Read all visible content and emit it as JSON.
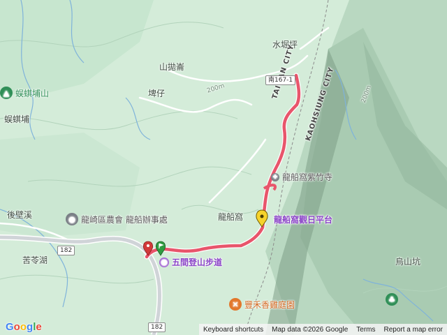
{
  "map": {
    "places": {
      "shuijueping": "水堀坪",
      "shanpaohu": "山拋崙",
      "pizai": "埤仔",
      "wuqibushan": "蜈蜞埔山",
      "wuqibu": "蜈蜞埔",
      "houbixi": "後壁溪",
      "longchuanwo": "龍船窩",
      "kulinhu": "苦苓湖",
      "wushankeng": "烏山坑"
    },
    "pois": {
      "farmers_assoc": "龍崎區農會 龍船辦事處",
      "zizhu_temple": "龍船窩紫竹寺",
      "sunrise_platform": "龍船窩觀日平台",
      "wujian_trail": "五間登山步道",
      "fenghe_restaurant": "豐禾香雞庭園"
    },
    "city_labels": {
      "tainan": "TAINAN CITY",
      "kaohsiung": "KAOHSIUNG CITY"
    },
    "elevation_labels": [
      "200m",
      "200m"
    ],
    "road_shields": {
      "nan167": "南167-1",
      "r182_top": "182",
      "r182_bottom": "182"
    },
    "colors": {
      "route": "#e8556b",
      "route_outline": "#ffffff",
      "poi_purple": "#9b59d0",
      "poi_gray": "#7a7f86",
      "poi_orange": "#e2772b",
      "poi_green": "#2f8f57",
      "start_green": "#2e9b3f",
      "end_red": "#d23a3a",
      "yellow_pin": "#f6d32b"
    }
  },
  "footer": {
    "logo": "Google",
    "shortcuts": "Keyboard shortcuts",
    "map_data": "Map data ©2026 Google",
    "terms": "Terms",
    "report": "Report a map error"
  }
}
